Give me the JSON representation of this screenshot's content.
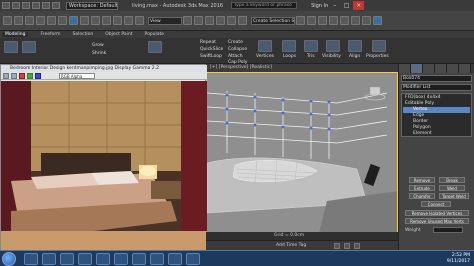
{
  "titlebar": {
    "workspace": "Workspace: Default",
    "title": "living.max - Autodesk 3ds Max 2016",
    "search_placeholder": "Type a keyword or phrase",
    "signin": "Sign In"
  },
  "menubar": {
    "view_dropdown": "View",
    "selection_set": "Create Selection Set"
  },
  "ribbon": {
    "tabs": [
      "Modeling",
      "Freeform",
      "Selection",
      "Object Paint",
      "Populate"
    ],
    "active_tab": "Modeling",
    "buttons": {
      "repeat": "Repeat",
      "collapse": "Collapse",
      "quickslice": "QuickSlice",
      "swiftloop": "SwiftLoop",
      "create": "Create",
      "attach": "Attach",
      "cap_poly": "Cap Poly",
      "grow": "Grow",
      "shrink": "Shrink",
      "vertices": "Vertices",
      "loops": "Loops",
      "tris": "Tris",
      "visibility": "Visibility",
      "align": "Align",
      "properties": "Properties"
    }
  },
  "docwindow": {
    "title": "Bedroom Interior Design kerdmanpimping.jpg Display Gamma 2.2",
    "channel": "RGB Alpha"
  },
  "viewport": {
    "label": "[+] [Perspective] [Realistic]"
  },
  "cmdpanel": {
    "object_name": "Box074",
    "modifier_list": "Modifier List",
    "stack": [
      {
        "label": "FFD(box) 4x4x4",
        "level": 0,
        "selected": false
      },
      {
        "label": "Editable Poly",
        "level": 0,
        "selected": false
      },
      {
        "label": "Vertex",
        "level": 1,
        "selected": true
      },
      {
        "label": "Edge",
        "level": 1,
        "selected": false
      },
      {
        "label": "Border",
        "level": 1,
        "selected": false
      },
      {
        "label": "Polygon",
        "level": 1,
        "selected": false
      },
      {
        "label": "Element",
        "level": 1,
        "selected": false
      }
    ],
    "buttons": {
      "remove": "Remove",
      "break": "Break",
      "extrude": "Extrude",
      "weld": "Weld",
      "chamfer": "Chamfer",
      "target_weld": "Target Weld",
      "connect": "Connect",
      "remove_isolated": "Remove Isolated Vertices",
      "remove_unused": "Remove Unused Map Verts",
      "weight": "Weight"
    }
  },
  "status": {
    "grid": "Grid = 0.0cm",
    "add_time_tag": "Add Time Tag"
  },
  "taskbar": {
    "time": "2:52 PM",
    "date": "9/11/2017"
  }
}
